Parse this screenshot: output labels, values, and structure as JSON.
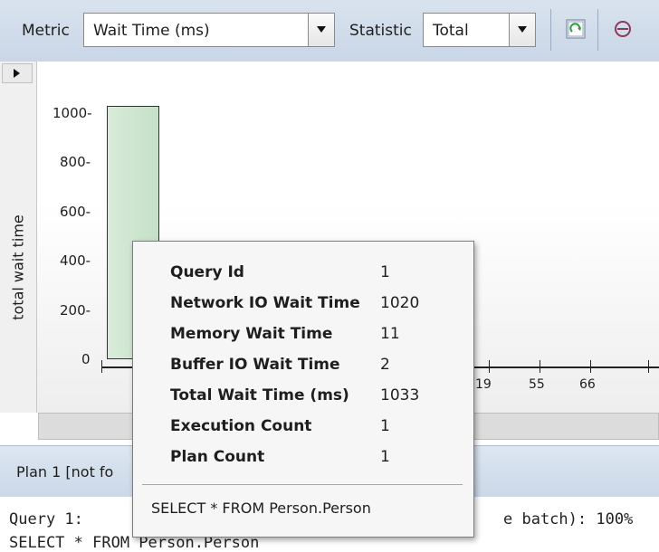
{
  "toolbar": {
    "metric_label": "Metric",
    "metric_value": "Wait Time (ms)",
    "statistic_label": "Statistic",
    "statistic_value": "Total",
    "icons": [
      "refresh-icon",
      "target-icon"
    ]
  },
  "chart": {
    "ylabel": "total wait time",
    "yticks": [
      "1000-",
      "800-",
      "600-",
      "400-",
      "200-",
      "0"
    ],
    "xticks_visible": [
      "19",
      "55",
      "66"
    ]
  },
  "chart_data": {
    "type": "bar",
    "ylabel": "total wait time",
    "ylim": [
      0,
      1000
    ],
    "categories": [
      "1"
    ],
    "values": [
      1033
    ]
  },
  "tooltip": {
    "rows": [
      {
        "key": "Query Id",
        "value": "1"
      },
      {
        "key": "Network IO Wait Time",
        "value": "1020"
      },
      {
        "key": "Memory Wait Time",
        "value": "11"
      },
      {
        "key": "Buffer IO Wait Time",
        "value": "2"
      },
      {
        "key": "Total Wait Time (ms)",
        "value": "1033"
      },
      {
        "key": "Execution Count",
        "value": "1"
      },
      {
        "key": "Plan Count",
        "value": "1"
      }
    ],
    "sql": "SELECT * FROM Person.Person"
  },
  "plan": {
    "title": "Plan 1 [not fo",
    "code_line1_start": "Query 1:",
    "code_line1_end": "e batch): 100%",
    "code_line2": "SELECT * FROM Person.Person"
  },
  "colors": {
    "bar_fill": "#c6e0c8",
    "toolbar_bg": "#c9d6e6"
  }
}
